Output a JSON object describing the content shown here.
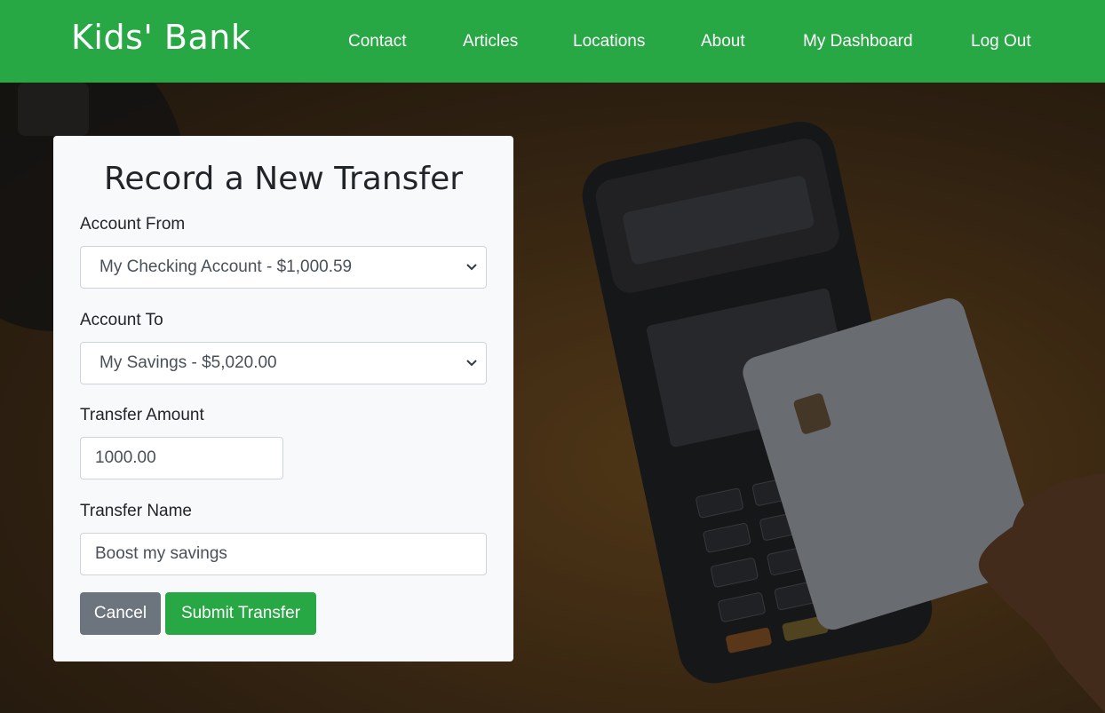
{
  "navbar": {
    "brand": "Kids' Bank",
    "links": [
      "Contact",
      "Articles",
      "Locations",
      "About",
      "My Dashboard",
      "Log Out"
    ]
  },
  "form": {
    "title": "Record a New Transfer",
    "account_from": {
      "label": "Account From",
      "selected": "My Checking Account - $1,000.59"
    },
    "account_to": {
      "label": "Account To",
      "selected": "My Savings - $5,020.00"
    },
    "amount": {
      "label": "Transfer Amount",
      "value": "1000.00"
    },
    "name": {
      "label": "Transfer Name",
      "value": "Boost my savings"
    },
    "cancel_label": "Cancel",
    "submit_label": "Submit Transfer"
  },
  "colors": {
    "brand_green": "#28a745",
    "cancel_gray": "#6c757d",
    "card_bg": "#f8f9fa"
  },
  "icons": [
    "chevron-down-icon",
    "chevron-down-icon"
  ]
}
